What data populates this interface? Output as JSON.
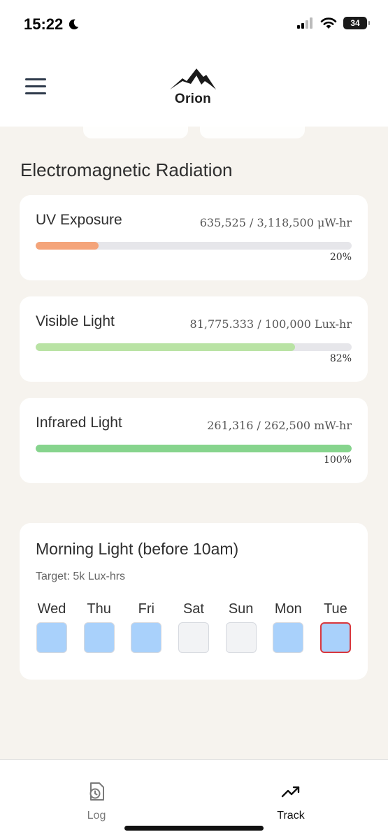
{
  "status": {
    "time": "15:22",
    "battery": "34",
    "icons": [
      "moon-icon",
      "signal-icon",
      "wifi-icon",
      "battery-icon"
    ]
  },
  "header": {
    "logo_text": "Orion",
    "icons": [
      "menu-icon",
      "mountain-logo"
    ]
  },
  "section": {
    "title": "Electromagnetic Radiation"
  },
  "radiation": [
    {
      "label": "UV Exposure",
      "value": "635,525 / 3,118,500 μW-hr",
      "percent": "20%",
      "fraction": 0.2,
      "color": "#f4a47a"
    },
    {
      "label": "Visible Light",
      "value": "81,775.333 / 100,000 Lux-hr",
      "percent": "82%",
      "fraction": 0.82,
      "color": "#b9e3a4"
    },
    {
      "label": "Infrared Light",
      "value": "261,316 / 262,500 mW-hr",
      "percent": "100%",
      "fraction": 1.0,
      "color": "#86d48d"
    }
  ],
  "morning": {
    "title": "Morning Light (before 10am)",
    "target": "Target: 5k Lux-hrs",
    "days": [
      {
        "label": "Wed",
        "met": true,
        "today": false
      },
      {
        "label": "Thu",
        "met": true,
        "today": false
      },
      {
        "label": "Fri",
        "met": true,
        "today": false
      },
      {
        "label": "Sat",
        "met": false,
        "today": false
      },
      {
        "label": "Sun",
        "met": false,
        "today": false
      },
      {
        "label": "Mon",
        "met": true,
        "today": false
      },
      {
        "label": "Tue",
        "met": true,
        "today": true
      }
    ],
    "colors": {
      "met": "#a9d1fb",
      "unmet": "#f2f3f5",
      "today_border": "#d9373d"
    }
  },
  "tabs": [
    {
      "label": "Log",
      "icon": "log-clock-icon",
      "active": false
    },
    {
      "label": "Track",
      "icon": "trend-up-icon",
      "active": true
    }
  ],
  "colors": {
    "tab_active": "#111111",
    "tab_inactive": "#7a7a7a"
  }
}
